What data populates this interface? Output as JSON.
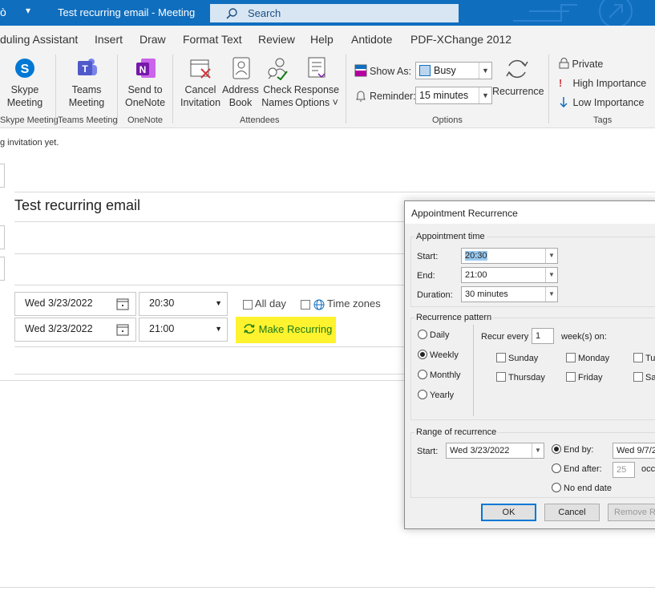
{
  "window": {
    "title": "Test recurring email  -  Meeting",
    "search_placeholder": "Search"
  },
  "menubar": [
    "duling Assistant",
    "Insert",
    "Draw",
    "Format Text",
    "Review",
    "Help",
    "Antidote",
    "PDF-XChange 2012"
  ],
  "ribbon": {
    "skype": {
      "line1": "Skype",
      "line2": "Meeting",
      "group": "Skype Meeting"
    },
    "teams": {
      "line1": "Teams",
      "line2": "Meeting",
      "group": "Teams Meeting"
    },
    "onenote": {
      "line1": "Send to",
      "line2": "OneNote",
      "group": "OneNote"
    },
    "cancel": {
      "line1": "Cancel",
      "line2": "Invitation"
    },
    "address": {
      "line1": "Address",
      "line2": "Book"
    },
    "check": {
      "line1": "Check",
      "line2": "Names"
    },
    "response": {
      "line1": "Response",
      "line2": "Options"
    },
    "attendees_group": "Attendees",
    "show_as_label": "Show As:",
    "show_as_value": "Busy",
    "reminder_label": "Reminder:",
    "reminder_value": "15 minutes",
    "recurrence_label": "Recurrence",
    "options_group": "Options",
    "private_label": "Private",
    "high_label": "High Importance",
    "low_label": "Low Importance",
    "tags_group": "Tags"
  },
  "info_bar": "g invitation yet.",
  "form": {
    "subject": "Test recurring email",
    "start_date": "Wed 3/23/2022",
    "start_time": "20:30",
    "end_date": "Wed 3/23/2022",
    "end_time": "21:00",
    "all_day": "All day",
    "time_zones": "Time zones",
    "make_recurring": "Make Recurring"
  },
  "dialog": {
    "title": "Appointment Recurrence",
    "appt_time": "Appointment time",
    "start_label": "Start:",
    "start_value": "20:30",
    "end_label": "End:",
    "end_value": "21:00",
    "duration_label": "Duration:",
    "duration_value": "30 minutes",
    "pattern": "Recurrence pattern",
    "daily": "Daily",
    "weekly": "Weekly",
    "monthly": "Monthly",
    "yearly": "Yearly",
    "recur_every": "Recur every",
    "recur_value": "1",
    "weeks_on": "week(s) on:",
    "sunday": "Sunday",
    "monday": "Monday",
    "tuesday": "Tu",
    "thursday": "Thursday",
    "friday": "Friday",
    "saturday": "Sat",
    "range": "Range of recurrence",
    "range_start_label": "Start:",
    "range_start_value": "Wed 3/23/2022",
    "end_by": "End by:",
    "end_by_value": "Wed 9/7/2",
    "end_after": "End after:",
    "end_after_value": "25",
    "occ": "occ",
    "no_end": "No end date",
    "ok": "OK",
    "cancel": "Cancel",
    "remove": "Remove Re"
  }
}
